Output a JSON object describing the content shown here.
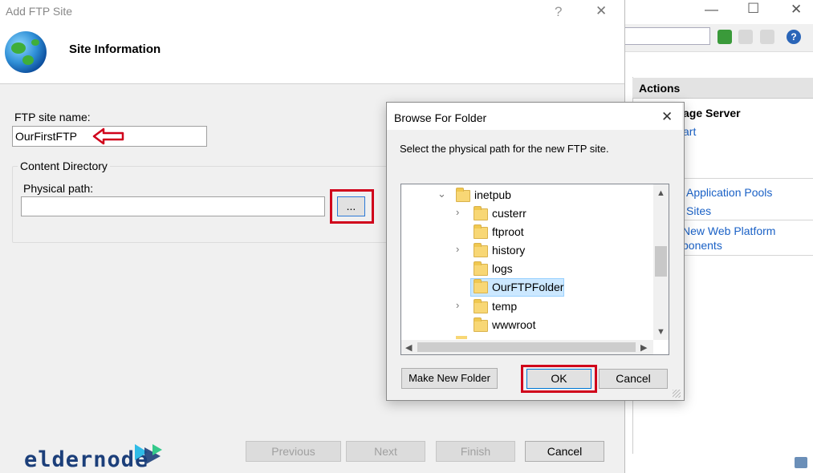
{
  "wizard": {
    "title": "Add FTP Site",
    "help_glyph": "?",
    "close_glyph": "✕",
    "header": "Site Information",
    "site_name_label": "FTP site name:",
    "site_name_value": "OurFirstFTP",
    "content_dir_label": "Content Directory",
    "physical_path_label": "Physical path:",
    "physical_path_value": "",
    "browse_label": "...",
    "buttons": {
      "previous": "Previous",
      "next": "Next",
      "finish": "Finish",
      "cancel": "Cancel"
    }
  },
  "browse_dialog": {
    "title": "Browse For Folder",
    "close_glyph": "✕",
    "instruction": "Select the physical path for the new FTP site.",
    "tree": [
      {
        "label": "inetpub",
        "chevron": "⌄",
        "depth": 0
      },
      {
        "label": "custerr",
        "chevron": "›",
        "depth": 1
      },
      {
        "label": "ftproot",
        "chevron": "",
        "depth": 1
      },
      {
        "label": "history",
        "chevron": "›",
        "depth": 1
      },
      {
        "label": "logs",
        "chevron": "",
        "depth": 1
      },
      {
        "label": "OurFTPFolder",
        "chevron": "",
        "depth": 1,
        "selected": true
      },
      {
        "label": "temp",
        "chevron": "›",
        "depth": 1
      },
      {
        "label": "wwwroot",
        "chevron": "",
        "depth": 1
      }
    ],
    "scroll_up": "▲",
    "scroll_down": "▼",
    "scroll_left": "◀",
    "scroll_right": "▶",
    "make_new_folder": "Make New Folder",
    "ok": "OK",
    "cancel": "Cancel"
  },
  "iis_actions": {
    "header": "Actions",
    "manage_server": "age Server",
    "restart": "art",
    "app_pools": "Application Pools",
    "sites": "Sites",
    "web_platform_1": "New Web Platform",
    "web_platform_2": "ponents",
    "minimize_glyph": "—",
    "maximize_glyph": "☐",
    "close_glyph": "✕"
  },
  "watermark": {
    "brand": "eldernode"
  },
  "colors": {
    "accent_red": "#d0021b",
    "link_blue": "#1a61c6",
    "selection": "#cce8ff"
  }
}
